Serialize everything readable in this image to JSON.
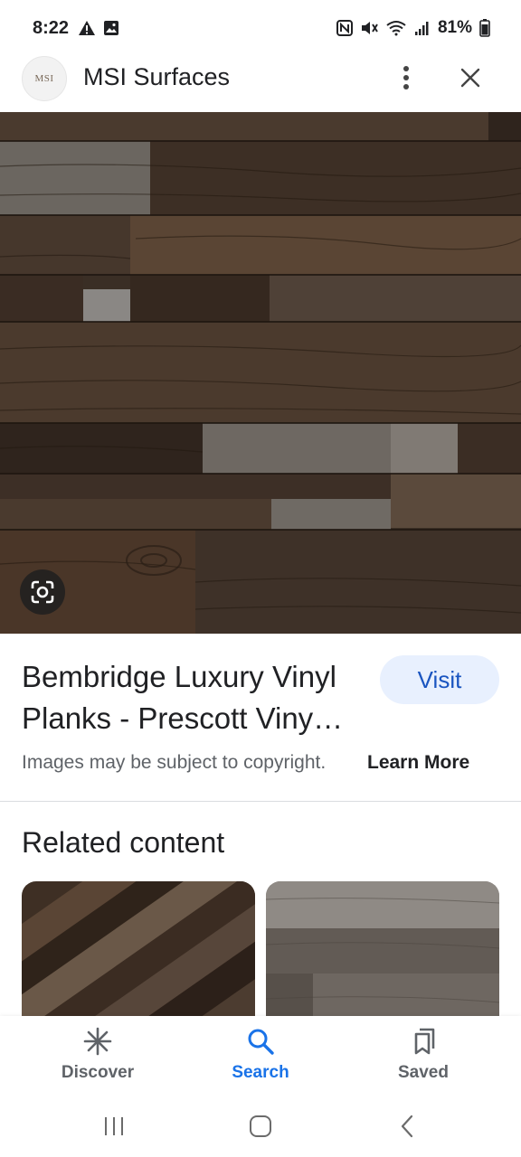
{
  "status": {
    "time": "8:22",
    "battery": "81%"
  },
  "header": {
    "logo_text": "MSI",
    "site_name": "MSI Surfaces"
  },
  "result": {
    "title": "Bembridge Luxury Vinyl Planks - Prescott Viny…",
    "visit_label": "Visit",
    "copyright_text": "Images may be subject to copyright.",
    "learn_more_label": "Learn More"
  },
  "related": {
    "heading": "Related content"
  },
  "bottom_nav": {
    "discover_label": "Discover",
    "search_label": "Search",
    "saved_label": "Saved",
    "active_color": "#1a73e8",
    "inactive_color": "#5f6368"
  },
  "colors": {
    "wood_dark": "#3a2e25",
    "visit_bg": "#e8f0fe",
    "visit_text": "#1a55c0"
  }
}
